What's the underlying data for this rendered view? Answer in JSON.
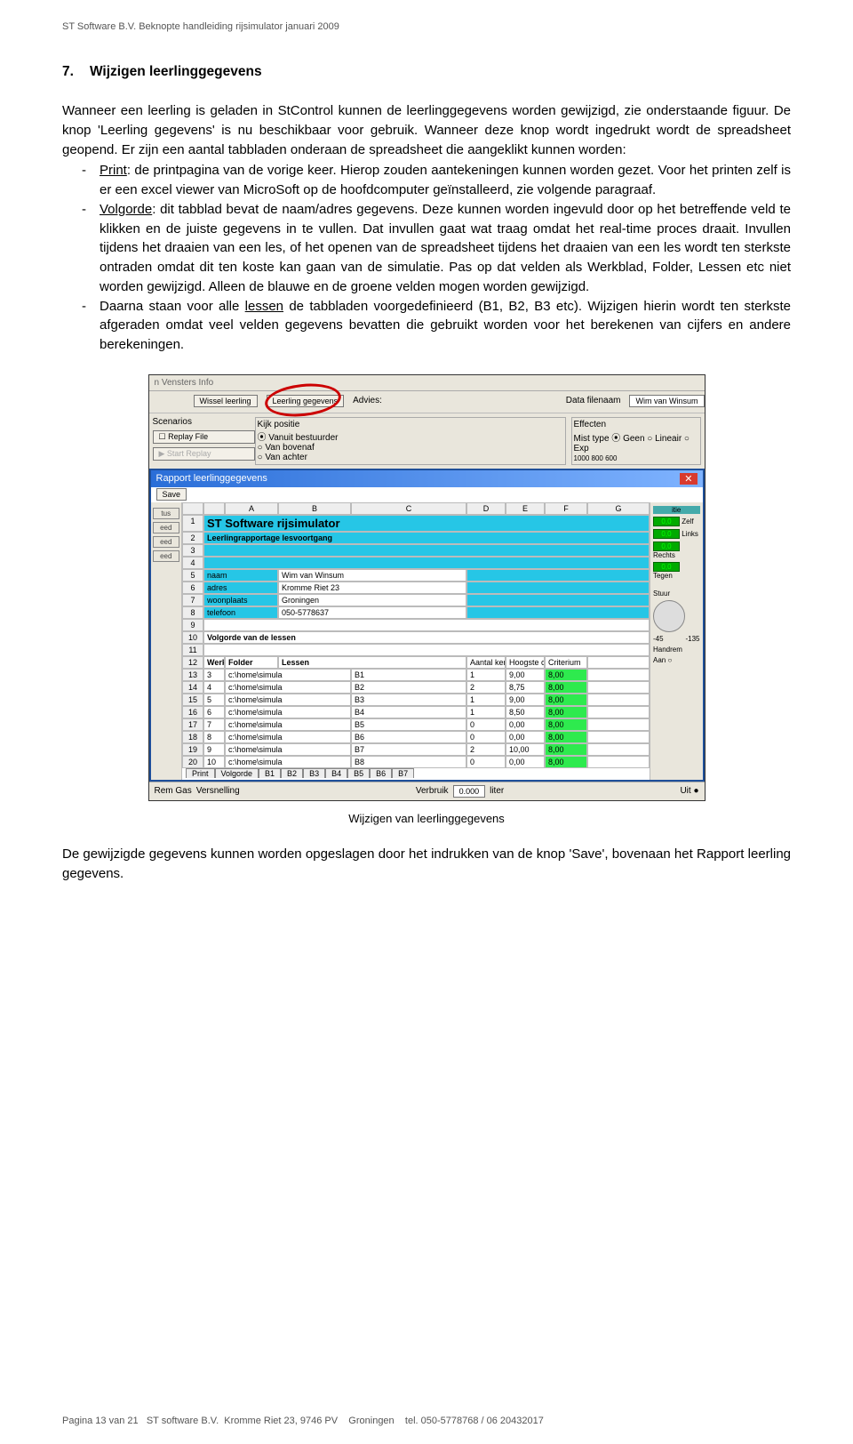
{
  "header": "ST Software B.V. Beknopte handleiding rijsimulator januari 2009",
  "section": {
    "number": "7.",
    "title": "Wijzigen leerlinggegevens"
  },
  "paragraphs": {
    "intro": "Wanneer een leerling is geladen in StControl kunnen de leerlinggegevens worden gewijzigd, zie onderstaande figuur. De knop 'Leerling gegevens' is nu beschikbaar voor gebruik. Wanneer deze knop wordt ingedrukt wordt de spreadsheet geopend. Er zijn een aantal tabbladen onderaan de spreadsheet die aangeklikt kunnen worden:",
    "outro": "De gewijzigde gegevens kunnen worden opgeslagen door het indrukken van de knop 'Save', bovenaan het Rapport leerling gegevens."
  },
  "bullets": {
    "print": {
      "label": "Print",
      "text": ": de printpagina van de vorige keer. Hierop zouden aantekeningen kunnen worden gezet. Voor het printen zelf is er een excel viewer van MicroSoft op de hoofdcomputer geïnstalleerd, zie volgende paragraaf."
    },
    "volgorde": {
      "label": "Volgorde",
      "text": ": dit tabblad bevat de naam/adres gegevens. Deze kunnen worden ingevuld door op het betreffende veld te klikken en de juiste gegevens in te vullen. Dat invullen gaat wat traag omdat het real-time proces draait. Invullen tijdens het draaien van een les, of het openen van de spreadsheet tijdens het draaien van een les wordt ten sterkste ontraden omdat dit ten koste kan gaan van de simulatie. Pas op dat velden als Werkblad, Folder, Lessen etc niet worden gewijzigd. Alleen de blauwe en de groene velden mogen worden gewijzigd."
    },
    "lessen": {
      "pre": "Daarna staan voor alle ",
      "u": "lessen",
      "post": " de tabbladen voorgedefinieerd (B1, B2, B3 etc). Wijzigen hierin wordt ten sterkste afgeraden omdat veel velden gegevens bevatten die gebruikt worden voor het berekenen van cijfers en andere berekeningen."
    }
  },
  "caption": "Wijzigen van leerlinggegevens",
  "mock": {
    "topmenu": "n   Vensters   Info",
    "top": {
      "btn1": "Wissel leerling",
      "btn2": "Leerling gegevens",
      "advies": "Advies:",
      "dfn_lbl": "Data filenaam",
      "dfn_val": "Wim van Winsum"
    },
    "left": {
      "scenarios": "Scenarios",
      "replay": "☐ Replay File",
      "start": "▶ Start Replay"
    },
    "right": {
      "kijk": {
        "title": "Kijk positie",
        "r1": "Vanuit bestuurder",
        "r2": "Van bovenaf",
        "r3": "Van achter"
      },
      "eff": {
        "title": "Effecten",
        "line": "Mist type   ⦿ Geen ○ Lineair ○ Exp",
        "vals": "1000  800  600"
      }
    },
    "dlg": {
      "title": "Rapport leerlinggegevens",
      "save": "Save",
      "cols": [
        "",
        "A",
        "B",
        "C",
        "D",
        "E",
        "F",
        "G"
      ],
      "header1": "ST Software rijsimulator",
      "header2": "Leerlingrapportage lesvoortgang",
      "header3": "Volgorde van de lessen",
      "info": [
        {
          "k": "naam",
          "v": "Wim van Winsum"
        },
        {
          "k": "adres",
          "v": "Kromme Riet 23"
        },
        {
          "k": "woonplaats",
          "v": "Groningen"
        },
        {
          "k": "telefoon",
          "v": "050-5778637"
        }
      ],
      "thead": [
        "Werkblad",
        "Folder",
        "Lessen",
        "Aantal keren",
        "Hoogste cij",
        "Criterium"
      ],
      "rows": [
        [
          "3",
          "c:\\home\\simula",
          "B1",
          "1",
          "9,00",
          "8,00"
        ],
        [
          "4",
          "c:\\home\\simula",
          "B2",
          "2",
          "8,75",
          "8,00"
        ],
        [
          "5",
          "c:\\home\\simula",
          "B3",
          "1",
          "9,00",
          "8,00"
        ],
        [
          "6",
          "c:\\home\\simula",
          "B4",
          "1",
          "8,50",
          "8,00"
        ],
        [
          "7",
          "c:\\home\\simula",
          "B5",
          "0",
          "0,00",
          "8,00"
        ],
        [
          "8",
          "c:\\home\\simula",
          "B6",
          "0",
          "0,00",
          "8,00"
        ],
        [
          "9",
          "c:\\home\\simula",
          "B7",
          "2",
          "10,00",
          "8,00"
        ],
        [
          "10",
          "c:\\home\\simula",
          "B8",
          "0",
          "0,00",
          "8,00"
        ]
      ],
      "tabs": [
        "Print",
        "Volgorde",
        "B1",
        "B2",
        "B3",
        "B4",
        "B5",
        "B6",
        "B7"
      ],
      "side": {
        "l": [
          "tus",
          "eed",
          "eed",
          "eed"
        ],
        "r": {
          "title": "itie",
          "vals": [
            "0,0",
            "0,0",
            "0,0",
            "0,0"
          ],
          "lbls": [
            "Zelf",
            "Links",
            "Rechts",
            "Tegen"
          ],
          "stuur": "Stuur",
          "dial": [
            "-45",
            "-135"
          ],
          "handrem": "Handrem",
          "aan": "Aan ○"
        }
      }
    },
    "foot": {
      "l1": "Rem   Gas",
      "l2": "Versnelling",
      "verbruik": "Verbruik",
      "val": "0.000",
      "liter": "liter",
      "uit": "Uit ●"
    }
  },
  "footer": {
    "page": "Pagina 13 van 21",
    "company": "ST software B.V.",
    "addr": "Kromme Riet 23, 9746 PV",
    "city": "Groningen",
    "tel": "tel. 050-5778768 / 06 20432017"
  }
}
